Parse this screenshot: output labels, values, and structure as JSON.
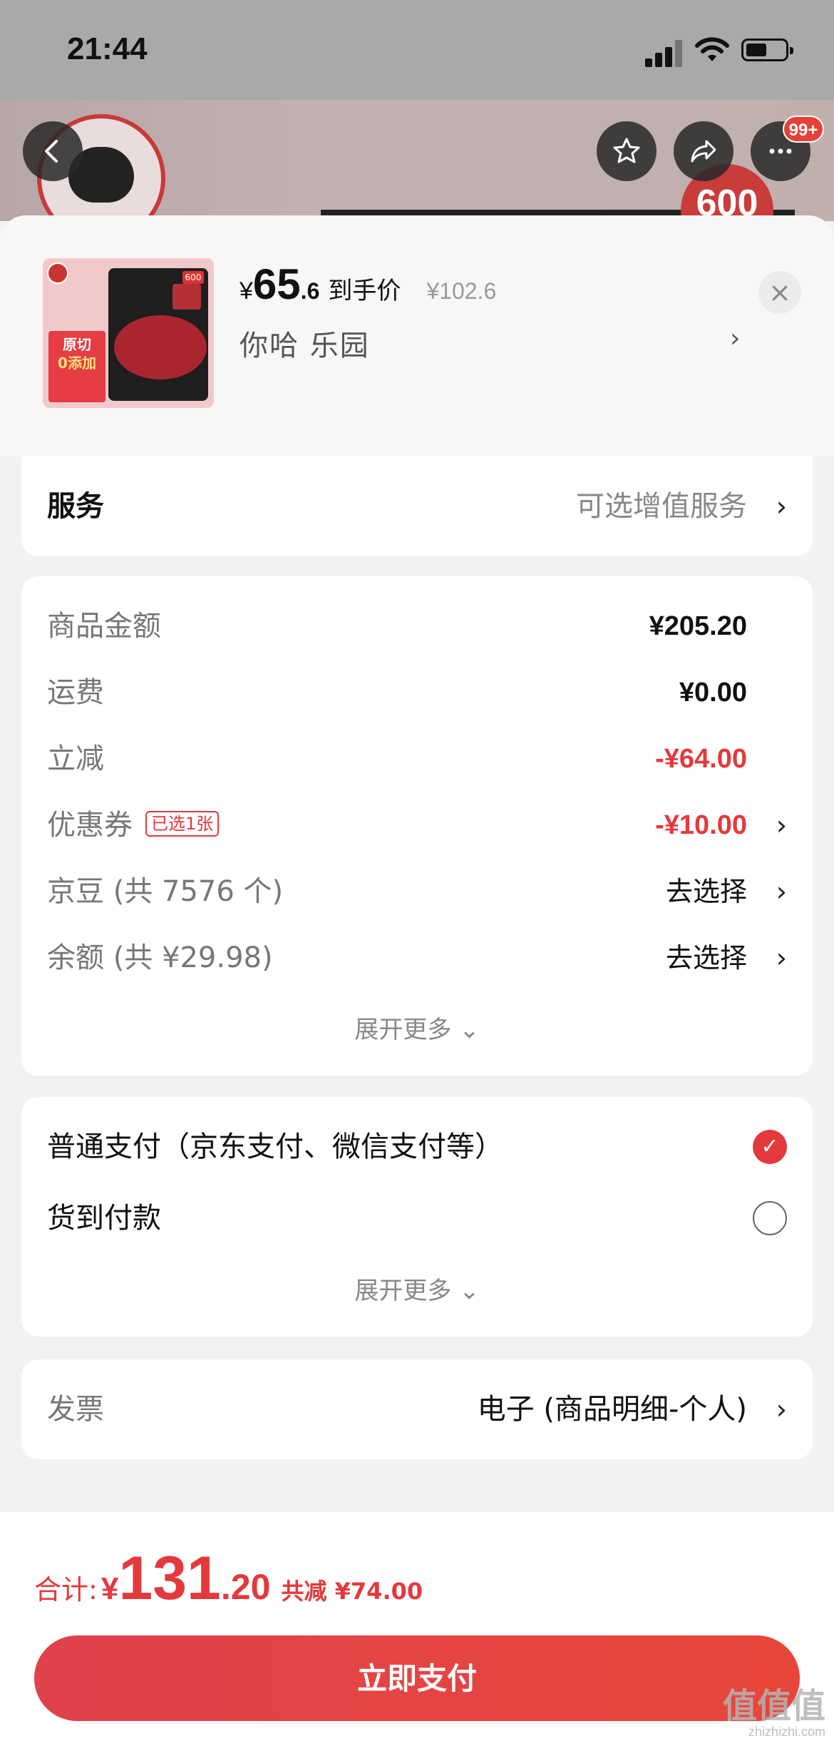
{
  "status_bar": {
    "time": "21:44"
  },
  "header": {
    "badge_count": "99+",
    "hero_badge": "600"
  },
  "product": {
    "currency": "¥",
    "price_int": "65",
    "price_dec": ".6",
    "price_label": "到手价",
    "original_price": "¥102.6",
    "spec": "你哈  乐园",
    "thumb_tag_line1": "原切",
    "thumb_tag_line2": "0添加"
  },
  "service": {
    "label": "服务",
    "value": "可选增值服务"
  },
  "costs": {
    "rows": [
      {
        "label": "商品金额",
        "value": "¥205.20"
      },
      {
        "label": "运费",
        "value": "¥0.00"
      },
      {
        "label": "立减",
        "value": "-¥64.00"
      },
      {
        "label": "优惠券",
        "chip": "已选1张",
        "value": "-¥10.00"
      },
      {
        "label": "京豆 (共 7576 个)",
        "value": "去选择"
      },
      {
        "label": "余额 (共 ¥29.98)",
        "value": "去选择"
      }
    ],
    "expand": "展开更多 ⌄"
  },
  "payment": {
    "options": [
      {
        "label": "普通支付（京东支付、微信支付等）",
        "selected": true
      },
      {
        "label": "货到付款",
        "selected": false
      }
    ],
    "expand": "展开更多 ⌄"
  },
  "invoice": {
    "label": "发票",
    "value": "电子 (商品明细-个人)"
  },
  "footer": {
    "total_label": "合计:",
    "currency": "¥",
    "total_int": "131",
    "total_dec": ".20",
    "saved": "共减 ¥74.00",
    "pay_button": "立即支付"
  },
  "watermark": {
    "text": "值值值",
    "sub": "zhizhizhi.com"
  },
  "colors": {
    "accent": "#e4393c",
    "background": "#f2f2f2"
  }
}
